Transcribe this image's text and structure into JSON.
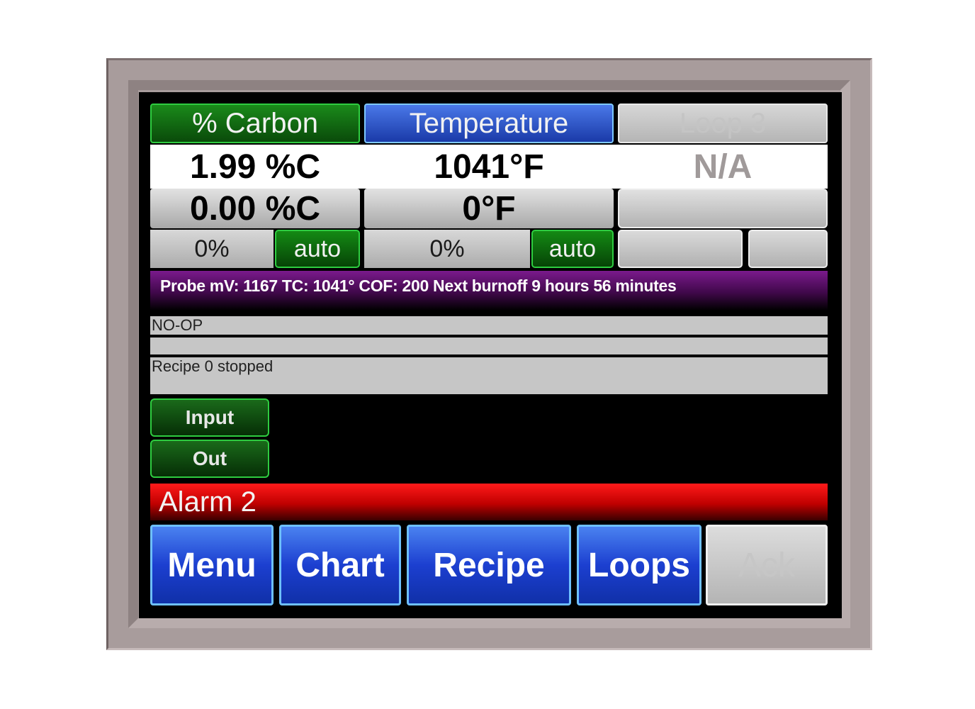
{
  "tabs": {
    "carbon": "% Carbon",
    "temperature": "Temperature",
    "loop3": "Loop 3"
  },
  "process_values": {
    "carbon": "1.99 %C",
    "temperature": "1041°F",
    "loop3": "N/A"
  },
  "setpoints": {
    "carbon": "0.00 %C",
    "temperature": "0°F"
  },
  "outputs": {
    "carbon_percent": "0%",
    "carbon_mode": "auto",
    "temperature_percent": "0%",
    "temperature_mode": "auto"
  },
  "status_line": "Probe mV: 1167  TC: 1041°  COF: 200  Next burnoff   9 hours 56 minutes",
  "info_lines": {
    "op": "NO-OP",
    "blank": "",
    "recipe": "Recipe 0 stopped"
  },
  "buttons": {
    "input": "Input",
    "out": "Out"
  },
  "alarm": "Alarm 2",
  "nav": {
    "menu": "Menu",
    "chart": "Chart",
    "recipe": "Recipe",
    "loops": "Loops",
    "ack": "Ack"
  }
}
